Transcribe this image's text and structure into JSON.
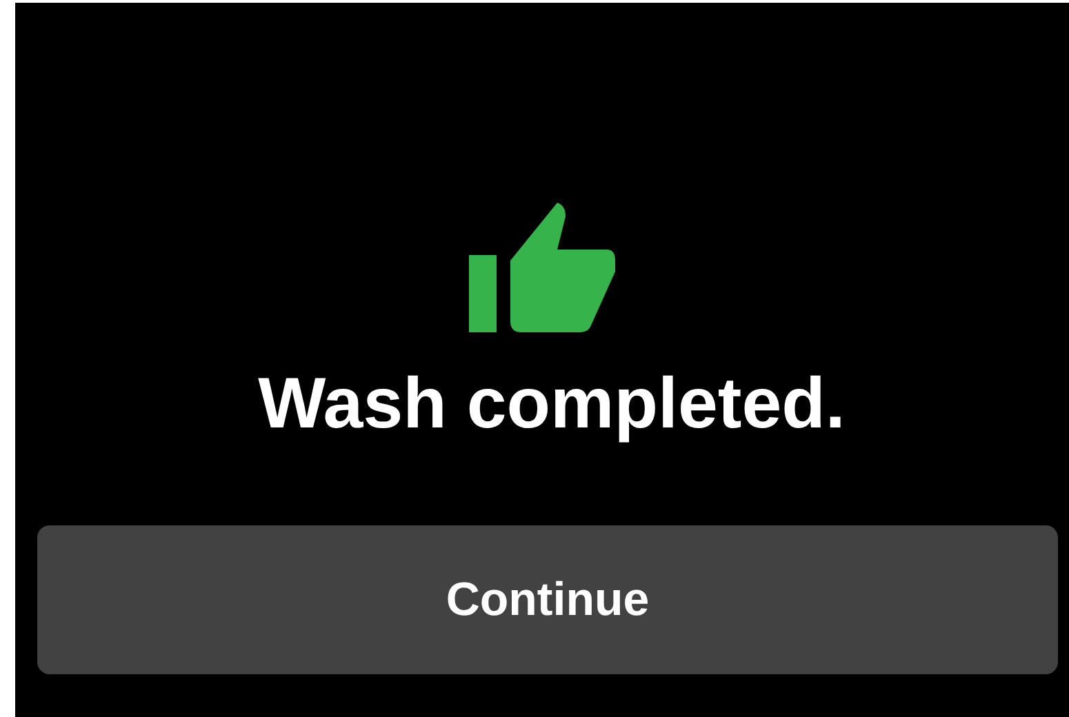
{
  "message": "Wash completed.",
  "button": {
    "label": "Continue"
  }
}
